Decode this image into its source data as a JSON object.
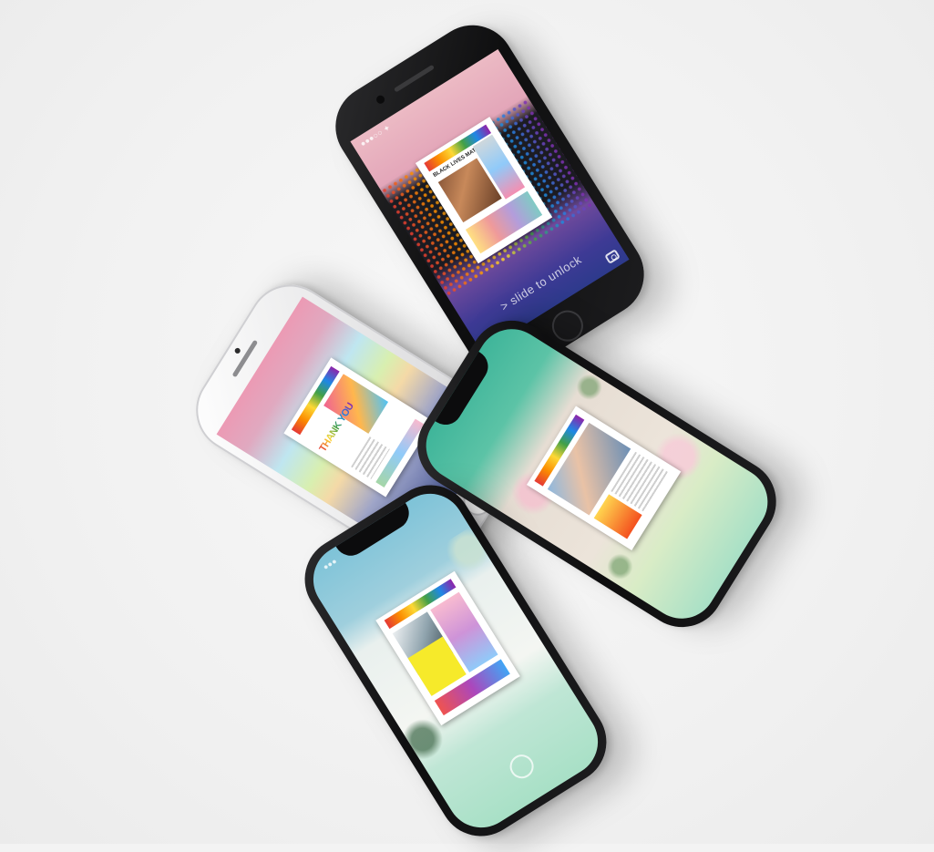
{
  "scene": {
    "background": "#f3f3f3",
    "devices": [
      {
        "id": "phone-top",
        "type": "iPhone 8 Plus (black)",
        "wallpaper": "pink-to-indigo gradient with rainbow halftone",
        "cover_headline": "BLACK LIVES MATTER",
        "lock_text": "> slide to unlock",
        "icon": "camera-icon"
      },
      {
        "id": "phone-left",
        "type": "iPhone (white)",
        "wallpaper": "pastel rainbow gradient",
        "cover_headline": "THANK YOU",
        "icon": "camera-icon"
      },
      {
        "id": "phone-right",
        "type": "iPhone X (black)",
        "wallpaper": "teal-to-cream gradient with roses"
      },
      {
        "id": "phone-bottom",
        "type": "iPhone X (black)",
        "wallpaper": "sky-blue-to-mint gradient with leaves",
        "icon": "home-ring-icon"
      }
    ]
  },
  "colors": {
    "pink": "#e8a3b6",
    "indigo": "#2c3a8c",
    "teal": "#3fb59a",
    "mint": "#a8e0c6",
    "sky": "#7ec3d8",
    "rainbow": [
      "#e53935",
      "#fb8c00",
      "#fdd835",
      "#43a047",
      "#1e88e5",
      "#8e24aa"
    ]
  }
}
